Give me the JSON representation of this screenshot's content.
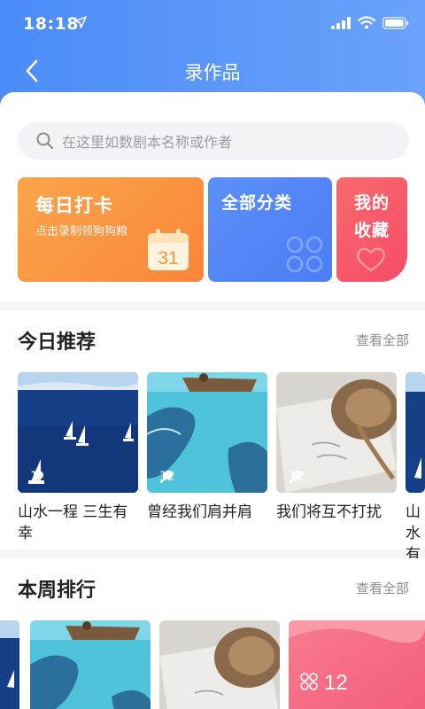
{
  "status": {
    "time": "18:18"
  },
  "nav": {
    "title": "录作品"
  },
  "search": {
    "placeholder": "在这里如数剧本名称或作者"
  },
  "tiles": {
    "daily": {
      "title": "每日打卡",
      "subtitle": "点击录制领狗狗粮",
      "day": "31"
    },
    "all": {
      "title": "全部分类"
    },
    "fav": {
      "title": "我的收藏"
    }
  },
  "recommend": {
    "title": "今日推荐",
    "more": "查看全部",
    "items": [
      {
        "count": "1",
        "title": "山水一程 三生有幸"
      },
      {
        "count": "12",
        "title": "曾经我们肩并肩"
      },
      {
        "count": "12",
        "title": "我们将互不打扰"
      },
      {
        "title": "山水有幸"
      }
    ]
  },
  "weekly": {
    "title": "本周排行",
    "more": "查看全部",
    "count": "12"
  },
  "colors": {
    "accent": "#4a8cf7",
    "orange": "#f9853a",
    "blue": "#4a7ef3",
    "red": "#f64c69"
  },
  "icons": [
    "back-icon",
    "search-icon",
    "calendar-icon",
    "grid-icon",
    "heart-icon",
    "mic-icon",
    "location-icon",
    "signal-icon",
    "wifi-icon",
    "battery-icon"
  ]
}
